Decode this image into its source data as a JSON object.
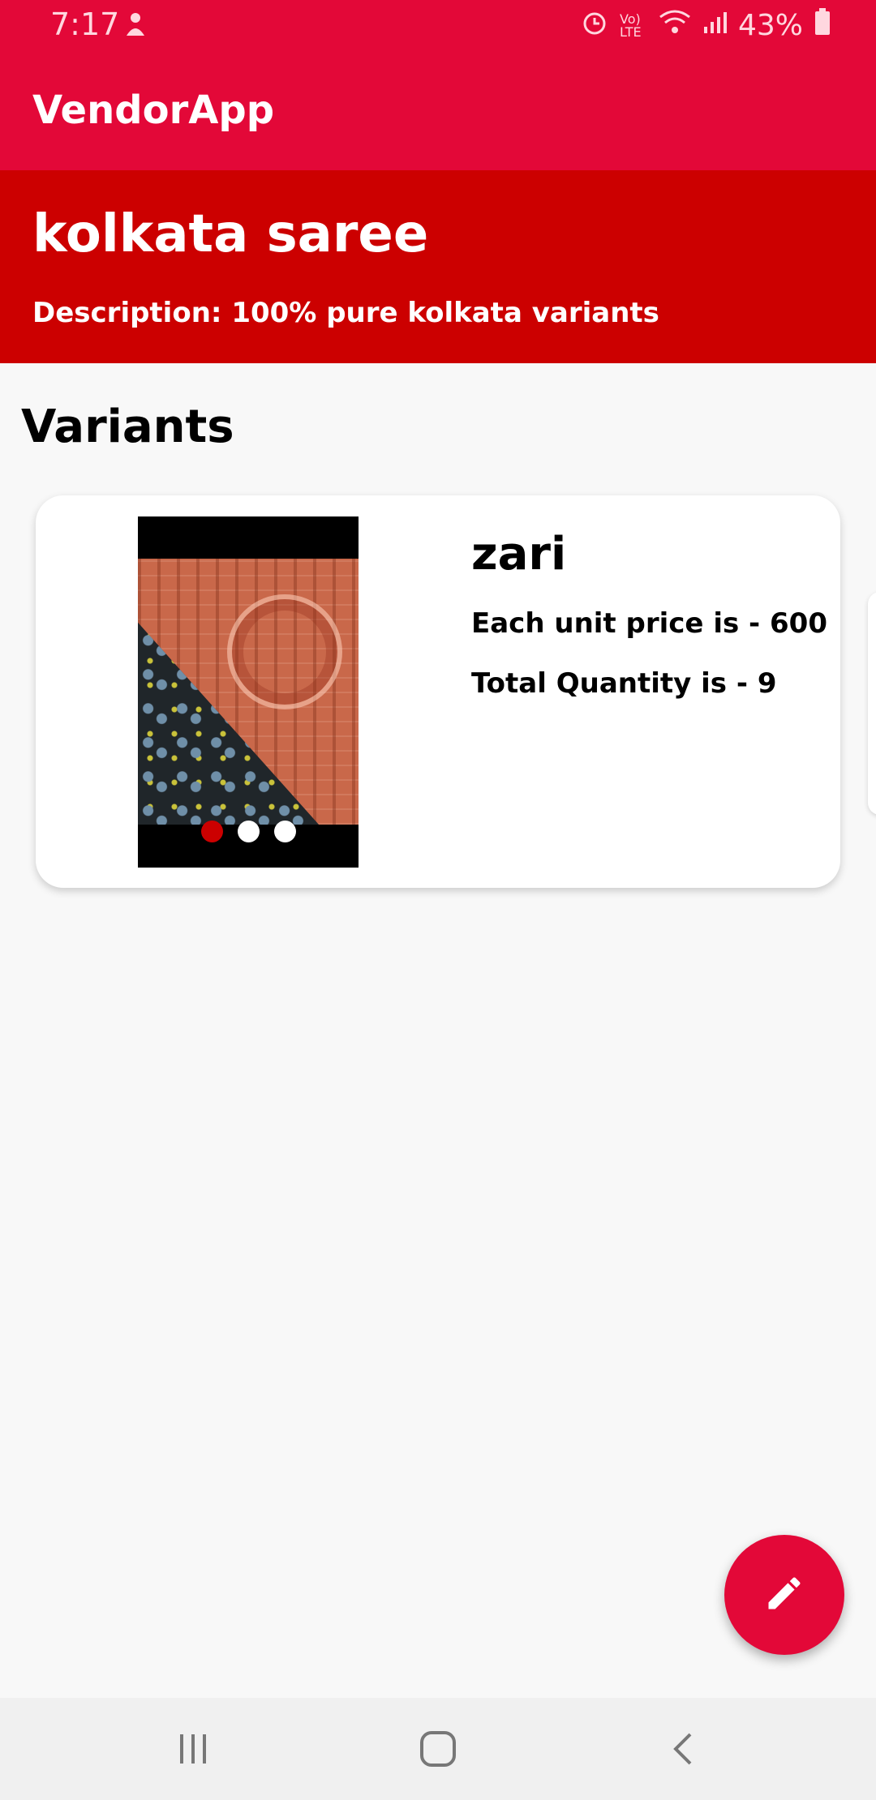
{
  "status_bar": {
    "time": "7:17",
    "battery_text": "43%",
    "network_label": "Vo) LTE",
    "icons": [
      "notification-icon",
      "alarm-icon",
      "volte-icon",
      "wifi-icon",
      "signal-icon",
      "battery-icon"
    ]
  },
  "app_bar": {
    "title": "VendorApp"
  },
  "product": {
    "name": "kolkata saree",
    "description": "Description: 100% pure kolkata variants"
  },
  "variants_section": {
    "title": "Variants",
    "items": [
      {
        "name": "zari",
        "price_text": "Each unit price is - 600",
        "quantity_text": "Total Quantity is - 9",
        "image_count": 3,
        "active_image_index": 0
      }
    ]
  },
  "fab": {
    "icon": "edit-pencil-icon"
  },
  "colors": {
    "app_bar": "#e30838",
    "header_panel": "#cc0000",
    "background": "#f8f8f8",
    "active_dot": "#cc0000"
  }
}
